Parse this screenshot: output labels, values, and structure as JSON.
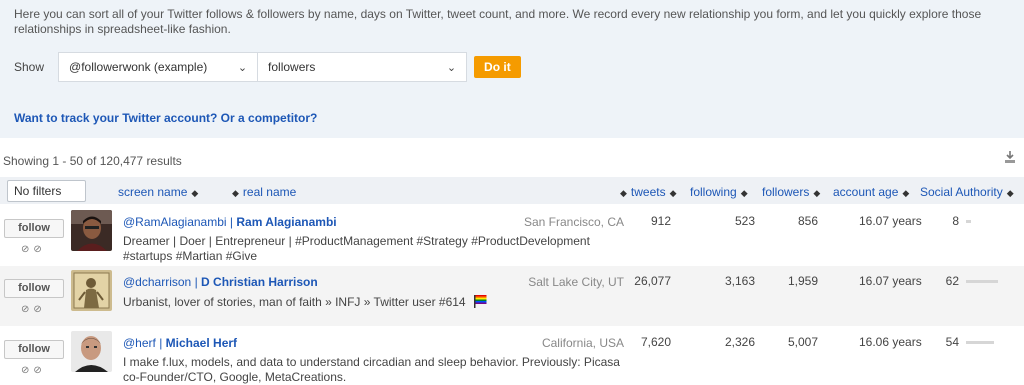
{
  "intro": {
    "text": "Here you can sort all of your Twitter follows & followers by name, days on Twitter, tweet count, and more. We record every new relationship you form, and let you quickly explore those relationships in spreadsheet-like fashion.",
    "show_label": "Show",
    "account_select": "@followerwonk (example)",
    "type_select": "followers",
    "do_button": "Do it",
    "track_link": "Want to track your Twitter account? Or a competitor?"
  },
  "results": {
    "summary": "Showing 1 - 50 of 120,477 results",
    "download_icon": "download-icon"
  },
  "table": {
    "filter_button": "No filters",
    "columns": {
      "screen_name": "screen name",
      "real_name": "real name",
      "tweets": "tweets",
      "following": "following",
      "followers": "followers",
      "account_age": "account age",
      "social_authority": "Social Authority"
    },
    "sort_glyph": "◆",
    "rows": [
      {
        "follow_label": "follow",
        "handle": "@RamAlagianambi",
        "separator": "|",
        "name": "Ram Alagianambi",
        "location": "San Francisco, CA",
        "bio": "Dreamer | Doer | Entrepreneur | #ProductManagement #Strategy #ProductDevelopment #startups #Martian #Give",
        "tweets": "912",
        "following": "523",
        "followers": "856",
        "age": "16.07 years",
        "authority": "8",
        "authority_value": 8
      },
      {
        "follow_label": "follow",
        "handle": "@dcharrison",
        "separator": "|",
        "name": "D Christian Harrison",
        "location": "Salt Lake City, UT",
        "bio": "Urbanist, lover of stories, man of faith » INFJ » Twitter user #614",
        "tweets": "26,077",
        "following": "3,163",
        "followers": "1,959",
        "age": "16.07 years",
        "authority": "62",
        "authority_value": 62
      },
      {
        "follow_label": "follow",
        "handle": "@herf",
        "separator": "|",
        "name": "Michael Herf",
        "location": "California, USA",
        "bio": "I make f.lux, models, and data to understand circadian and sleep behavior. Previously: Picasa co-Founder/CTO, Google, MetaCreations.",
        "tweets": "7,620",
        "following": "2,326",
        "followers": "5,007",
        "age": "16.06 years",
        "authority": "54",
        "authority_value": 54
      }
    ]
  },
  "colors": {
    "link_blue": "#1d57b6",
    "button_orange": "#f59b00",
    "intro_bg": "#eef3f8"
  }
}
